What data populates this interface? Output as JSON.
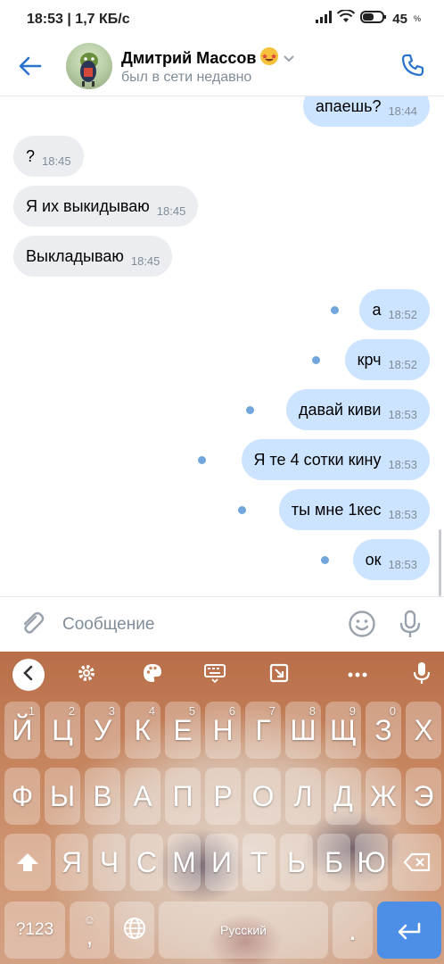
{
  "status_bar": {
    "time": "18:53",
    "network_speed": "1,7 КБ/с",
    "battery": "45"
  },
  "header": {
    "contact_name": "Дмитрий Массов",
    "contact_status": "был в сети недавно"
  },
  "messages": [
    {
      "direction": "out",
      "text": "апаешь?",
      "time": "18:44",
      "unread": false
    },
    {
      "direction": "in",
      "text": "?",
      "time": "18:45",
      "unread": false
    },
    {
      "direction": "in",
      "text": "Я их выкидываю",
      "time": "18:45",
      "unread": false
    },
    {
      "direction": "in",
      "text": "Выкладываю",
      "time": "18:45",
      "unread": false
    },
    {
      "direction": "out",
      "text": "а",
      "time": "18:52",
      "unread": true
    },
    {
      "direction": "out",
      "text": "крч",
      "time": "18:52",
      "unread": true
    },
    {
      "direction": "out",
      "text": "давай киви",
      "time": "18:53",
      "unread": true
    },
    {
      "direction": "out",
      "text": "Я те 4 сотки кину",
      "time": "18:53",
      "unread": true
    },
    {
      "direction": "out",
      "text": "ты мне 1кес",
      "time": "18:53",
      "unread": true
    },
    {
      "direction": "out",
      "text": "ок",
      "time": "18:53",
      "unread": true
    }
  ],
  "composer": {
    "placeholder": "Сообщение"
  },
  "keyboard": {
    "row1": [
      {
        "label": "Й",
        "hint": "1"
      },
      {
        "label": "Ц",
        "hint": "2"
      },
      {
        "label": "У",
        "hint": "3"
      },
      {
        "label": "К",
        "hint": "4"
      },
      {
        "label": "Е",
        "hint": "5"
      },
      {
        "label": "Н",
        "hint": "6"
      },
      {
        "label": "Г",
        "hint": "7"
      },
      {
        "label": "Ш",
        "hint": "8"
      },
      {
        "label": "Щ",
        "hint": "9"
      },
      {
        "label": "З",
        "hint": "0"
      },
      {
        "label": "Х",
        "hint": ""
      }
    ],
    "row2": [
      "Ф",
      "Ы",
      "В",
      "А",
      "П",
      "Р",
      "О",
      "Л",
      "Д",
      "Ж",
      "Э"
    ],
    "row3": [
      "Я",
      "Ч",
      "С",
      "М",
      "И",
      "Т",
      "Ь",
      "Б",
      "Ю"
    ],
    "symbols_label": "?123",
    "comma_label": ",",
    "space_label": "Русский",
    "period_label": "."
  },
  "colors": {
    "accent": "#2a73cc",
    "outgoing_bubble": "#cce4ff",
    "incoming_bubble": "#ebedf0",
    "unread_dot": "#71a6dc",
    "enter_key": "#4d8fe6"
  }
}
